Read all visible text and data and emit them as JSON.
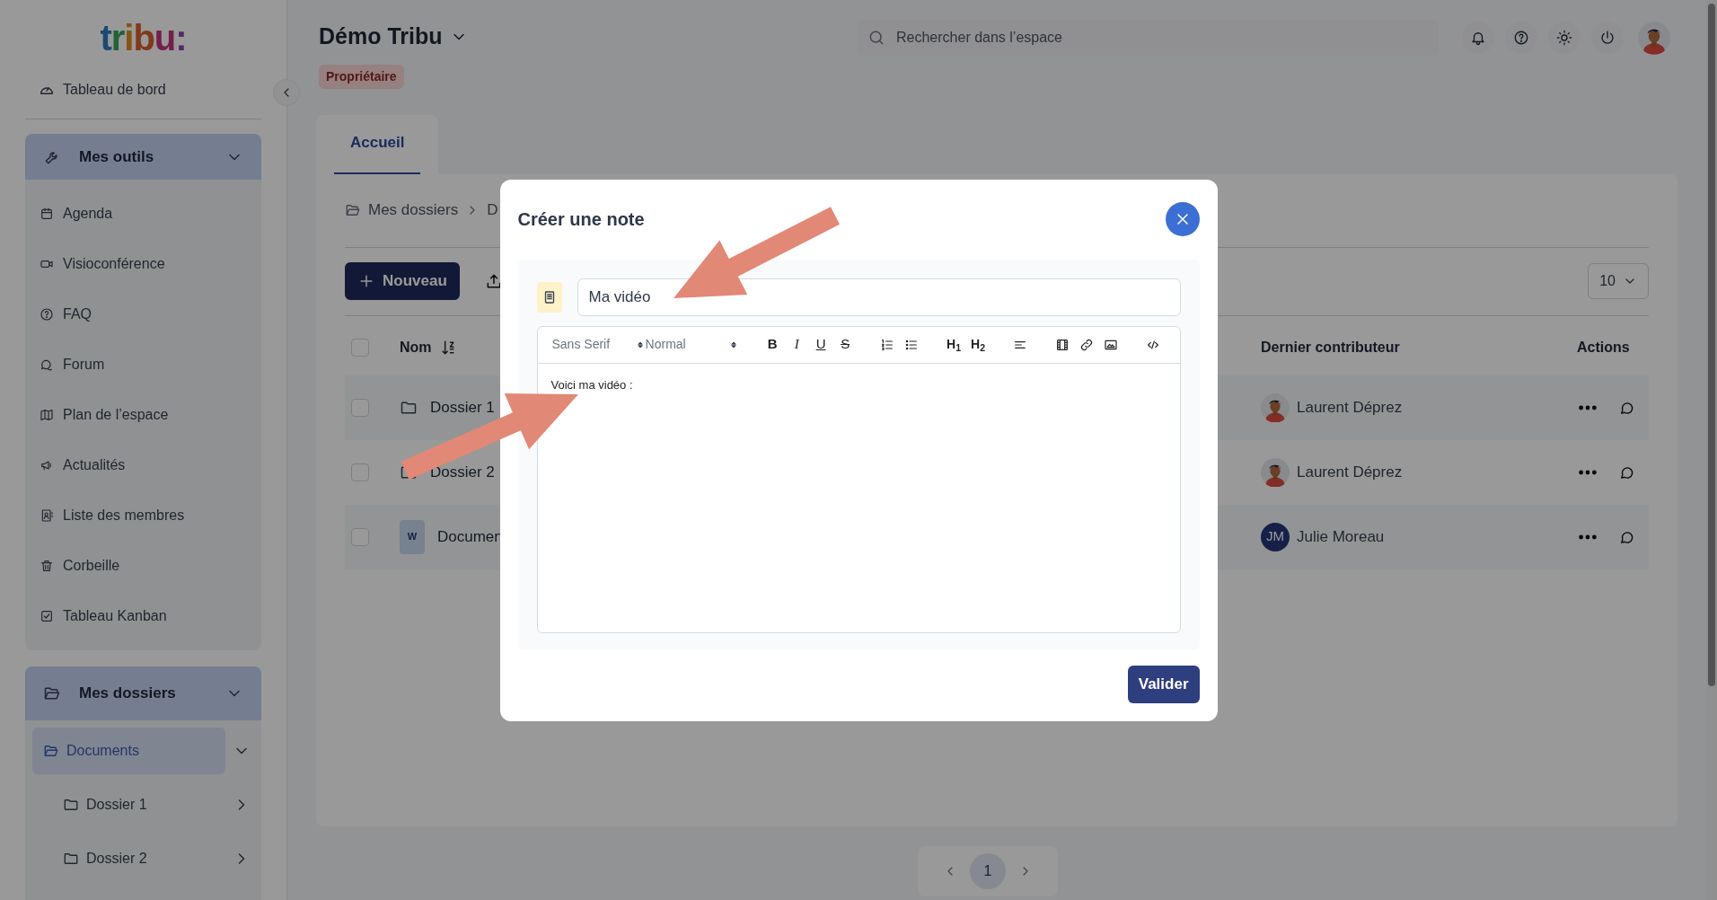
{
  "sidebar": {
    "logo": "tribu:",
    "dashboard": "Tableau de bord",
    "tools": {
      "title": "Mes outils",
      "expanded": true,
      "items": [
        "Agenda",
        "Visioconférence",
        "FAQ",
        "Forum",
        "Plan de l’espace",
        "Actualités",
        "Liste des membres",
        "Corbeille",
        "Tableau Kanban"
      ]
    },
    "folders": {
      "title": "Mes dossiers",
      "expanded": true,
      "items": [
        {
          "label": "Documents",
          "selected": true,
          "expanded": true,
          "children": [
            {
              "label": "Dossier 1",
              "selected": false,
              "expanded": false
            },
            {
              "label": "Dossier 2",
              "selected": false,
              "expanded": false
            }
          ]
        }
      ]
    }
  },
  "header": {
    "space_title": "Démo Tribu",
    "role_badge": "Propriétaire",
    "search": {
      "placeholder": "Rechercher dans l’espace"
    }
  },
  "tabs": [
    {
      "label": "Accueil",
      "selected": true
    }
  ],
  "breadcrumb": [
    "Mes dossiers",
    "D"
  ],
  "toolbar": {
    "new_button": "Nouveau",
    "page_size": "10"
  },
  "table": {
    "columns": [
      "Nom",
      "Dernier contributeur",
      "Actions"
    ],
    "header_checked": false,
    "rows": [
      {
        "kind": "folder",
        "name": "Dossier 1",
        "checked": false,
        "contributor": "Laurent Déprez"
      },
      {
        "kind": "folder",
        "name": "Dossier 2",
        "checked": false,
        "contributor": "Laurent Déprez"
      },
      {
        "kind": "document",
        "file_badge": "W",
        "name": "Documen",
        "checked": false,
        "contributor": "Julie Moreau",
        "initials": "JM"
      }
    ]
  },
  "pagination": {
    "pages": [
      {
        "label": "1",
        "selected": true
      }
    ]
  },
  "modal": {
    "title": "Créer une note",
    "note_title": {
      "value": "Ma vidéo"
    },
    "editor": {
      "toolbar": [
        {
          "kind": "select",
          "label": "Sans Serif"
        },
        {
          "kind": "select",
          "label": "Normal"
        },
        {
          "kind": "bold",
          "label": "B"
        },
        {
          "kind": "italic",
          "label": "I"
        },
        {
          "kind": "underline",
          "label": "U"
        },
        {
          "kind": "strike",
          "label": "S"
        },
        {
          "kind": "ordered-list"
        },
        {
          "kind": "bullet-list"
        },
        {
          "kind": "heading",
          "label": "H$_{1}$"
        },
        {
          "kind": "heading",
          "label": "H$_{2}$"
        },
        {
          "kind": "align"
        },
        {
          "kind": "video"
        },
        {
          "kind": "link"
        },
        {
          "kind": "image"
        },
        {
          "kind": "code"
        }
      ],
      "content": "Voici ma vidéo :"
    },
    "submit": "Valider"
  }
}
